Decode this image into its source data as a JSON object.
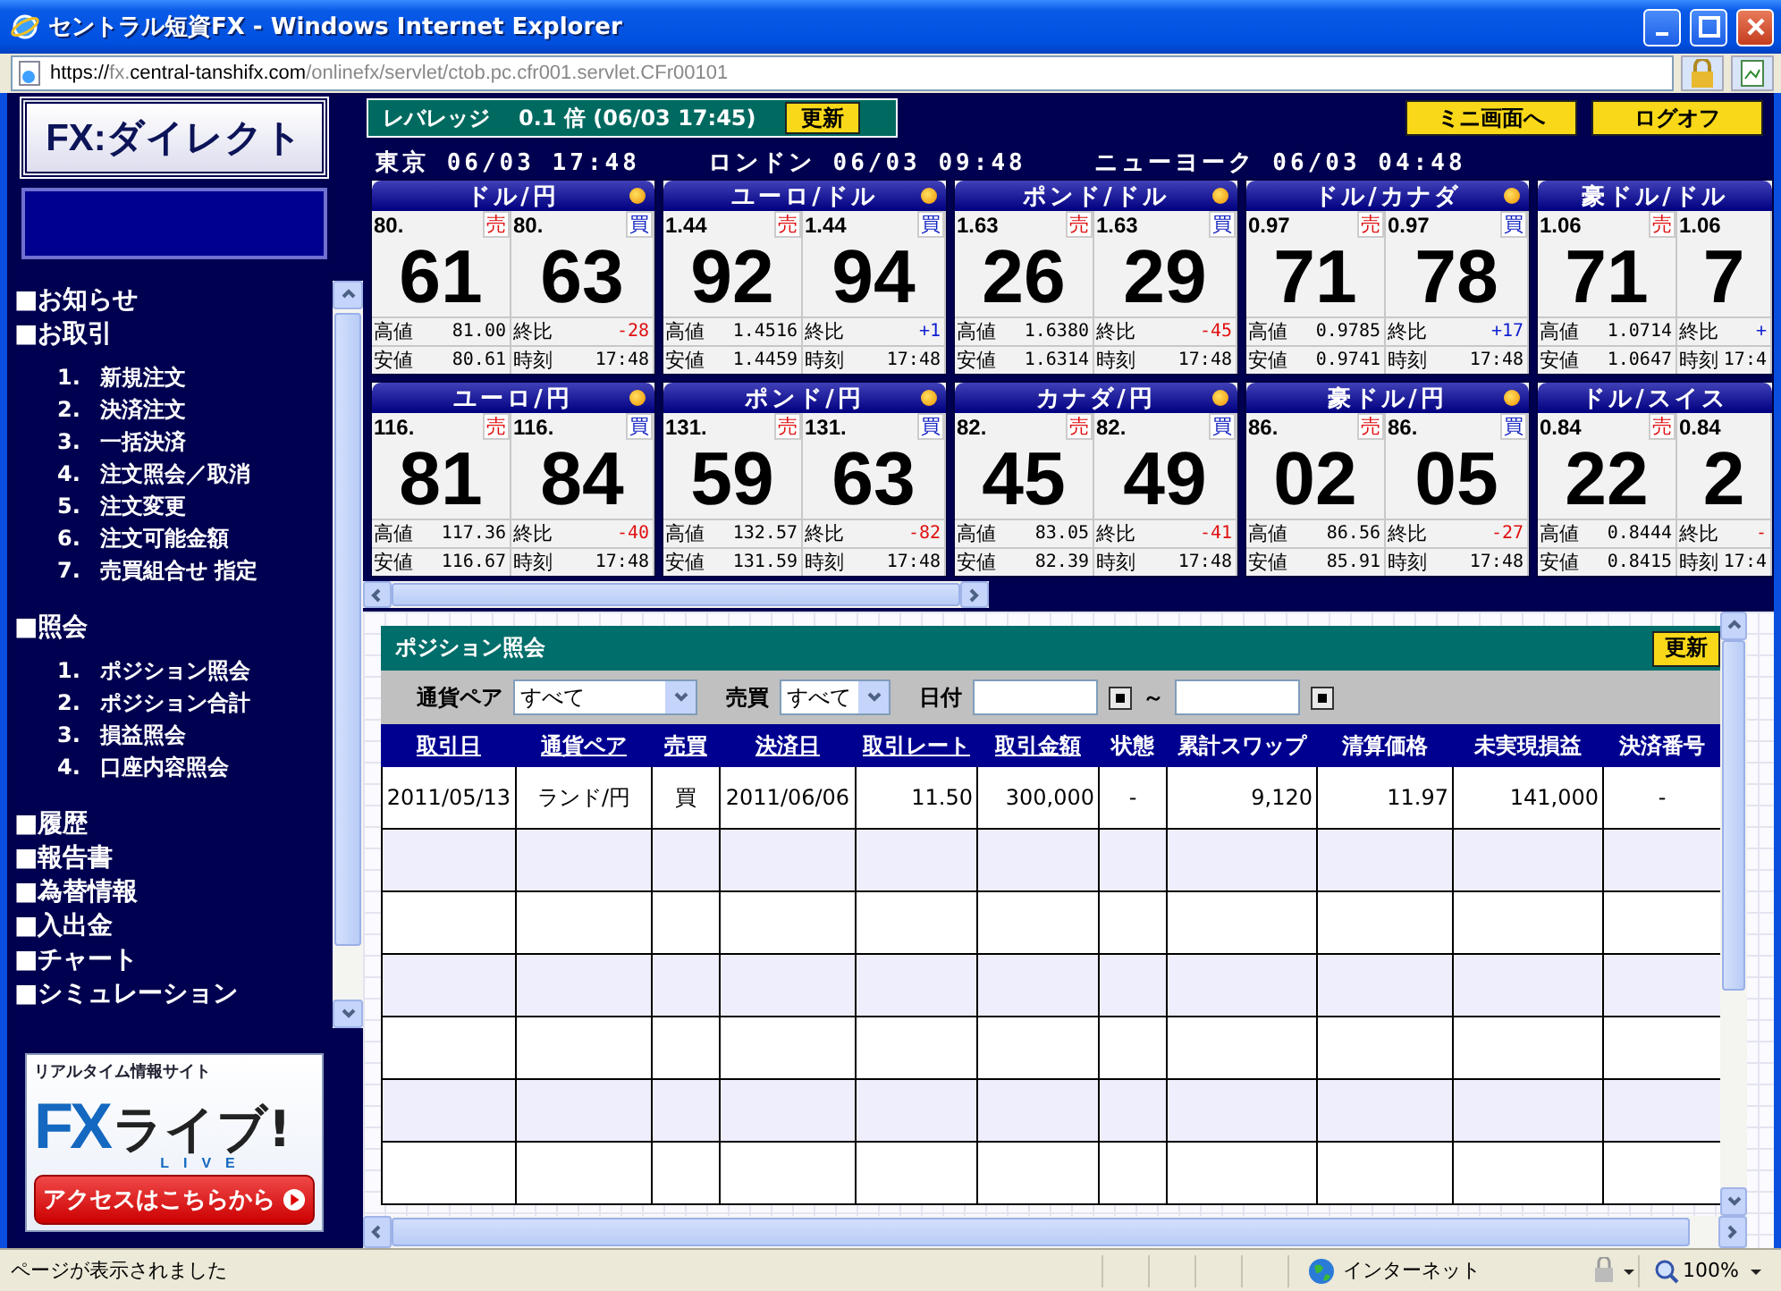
{
  "window": {
    "title": "セントラル短資FX - Windows Internet Explorer",
    "address": {
      "scheme": "https://",
      "subdomain": "fx.",
      "domain": "central-tanshifx.com",
      "path": "/onlinefx/servlet/ctob.pc.cfr001.servlet.CFr00101"
    }
  },
  "sidebar": {
    "logo": "FX:ダイレクト",
    "menu": [
      {
        "label": "■お知らせ"
      },
      {
        "label": "■お取引",
        "children": [
          {
            "number": "1.",
            "label": "新規注文"
          },
          {
            "number": "2.",
            "label": "決済注文"
          },
          {
            "number": "3.",
            "label": "一括決済"
          },
          {
            "number": "4.",
            "label": "注文照会／取消"
          },
          {
            "number": "5.",
            "label": "注文変更"
          },
          {
            "number": "6.",
            "label": "注文可能金額"
          },
          {
            "number": "7.",
            "label": "売買組合せ 指定"
          }
        ]
      },
      {
        "label": "■照会",
        "children": [
          {
            "number": "1.",
            "label": "ポジション照会"
          },
          {
            "number": "2.",
            "label": "ポジション合計"
          },
          {
            "number": "3.",
            "label": "損益照会"
          },
          {
            "number": "4.",
            "label": "口座内容照会"
          }
        ]
      },
      {
        "label": "■履歴"
      },
      {
        "label": "■報告書"
      },
      {
        "label": "■為替情報"
      },
      {
        "label": "■入出金"
      },
      {
        "label": "■チャート"
      },
      {
        "label": "■シミュレーション"
      }
    ],
    "banner": {
      "tagline": "リアルタイム情報サイト",
      "brand_fx": "FX",
      "brand_name": "ライブ!",
      "brand_sub": "LIVE",
      "button": "アクセスはこちらから"
    }
  },
  "header": {
    "leverage": {
      "label": "レバレッジ",
      "value": "0.1 倍",
      "time": "(06/03 17:45)",
      "button": "更新"
    },
    "buttons": [
      "ミニ画面へ",
      "ログオフ"
    ],
    "clocks": [
      {
        "city": "東京",
        "time": "06/03 17:48"
      },
      {
        "city": "ロンドン",
        "time": "06/03 09:48"
      },
      {
        "city": "ニューヨーク",
        "time": "06/03 04:48"
      }
    ]
  },
  "tiles": [
    {
      "pair": "ドル/円",
      "marker": true,
      "bid_head": "80.",
      "sell_label": "売",
      "bid_big": "61",
      "ask_head": "80.",
      "buy_label": "買",
      "ask_big": "63",
      "high_label": "高値",
      "high": "81.00",
      "change_label": "終比",
      "change": "-28",
      "rising": false,
      "low_label": "安値",
      "low": "80.61",
      "time_label": "時刻",
      "time": "17:48"
    },
    {
      "pair": "ユーロ/ドル",
      "marker": true,
      "bid_head": "1.44",
      "sell_label": "売",
      "bid_big": "92",
      "ask_head": "1.44",
      "buy_label": "買",
      "ask_big": "94",
      "high_label": "高値",
      "high": "1.4516",
      "change_label": "終比",
      "change": "+1",
      "rising": true,
      "low_label": "安値",
      "low": "1.4459",
      "time_label": "時刻",
      "time": "17:48"
    },
    {
      "pair": "ポンド/ドル",
      "marker": true,
      "bid_head": "1.63",
      "sell_label": "売",
      "bid_big": "26",
      "ask_head": "1.63",
      "buy_label": "買",
      "ask_big": "29",
      "high_label": "高値",
      "high": "1.6380",
      "change_label": "終比",
      "change": "-45",
      "rising": false,
      "low_label": "安値",
      "low": "1.6314",
      "time_label": "時刻",
      "time": "17:48"
    },
    {
      "pair": "ドル/カナダ",
      "marker": true,
      "bid_head": "0.97",
      "sell_label": "売",
      "bid_big": "71",
      "ask_head": "0.97",
      "buy_label": "買",
      "ask_big": "78",
      "high_label": "高値",
      "high": "0.9785",
      "change_label": "終比",
      "change": "+17",
      "rising": true,
      "low_label": "安値",
      "low": "0.9741",
      "time_label": "時刻",
      "time": "17:48"
    },
    {
      "pair": "豪ドル/ドル",
      "marker": false,
      "bid_head": "1.06",
      "sell_label": "売",
      "bid_big": "71",
      "ask_head": "1.06",
      "ask_big": "7",
      "high_label": "高値",
      "high": "1.0714",
      "change_label": "終比",
      "change": "+",
      "rising": true,
      "low_label": "安値",
      "low": "1.0647",
      "time_label": "時刻",
      "time": "17:4"
    },
    {
      "pair": "ユーロ/円",
      "marker": true,
      "bid_head": "116.",
      "sell_label": "売",
      "bid_big": "81",
      "ask_head": "116.",
      "buy_label": "買",
      "ask_big": "84",
      "high_label": "高値",
      "high": "117.36",
      "change_label": "終比",
      "change": "-40",
      "rising": false,
      "low_label": "安値",
      "low": "116.67",
      "time_label": "時刻",
      "time": "17:48"
    },
    {
      "pair": "ポンド/円",
      "marker": true,
      "bid_head": "131.",
      "sell_label": "売",
      "bid_big": "59",
      "ask_head": "131.",
      "buy_label": "買",
      "ask_big": "63",
      "high_label": "高値",
      "high": "132.57",
      "change_label": "終比",
      "change": "-82",
      "rising": false,
      "low_label": "安値",
      "low": "131.59",
      "time_label": "時刻",
      "time": "17:48"
    },
    {
      "pair": "カナダ/円",
      "marker": true,
      "bid_head": "82.",
      "sell_label": "売",
      "bid_big": "45",
      "ask_head": "82.",
      "buy_label": "買",
      "ask_big": "49",
      "high_label": "高値",
      "high": "83.05",
      "change_label": "終比",
      "change": "-41",
      "rising": false,
      "low_label": "安値",
      "low": "82.39",
      "time_label": "時刻",
      "time": "17:48"
    },
    {
      "pair": "豪ドル/円",
      "marker": true,
      "bid_head": "86.",
      "sell_label": "売",
      "bid_big": "02",
      "ask_head": "86.",
      "buy_label": "買",
      "ask_big": "05",
      "high_label": "高値",
      "high": "86.56",
      "change_label": "終比",
      "change": "-27",
      "rising": false,
      "low_label": "安値",
      "low": "85.91",
      "time_label": "時刻",
      "time": "17:48"
    },
    {
      "pair": "ドル/スイス",
      "marker": false,
      "bid_head": "0.84",
      "sell_label": "売",
      "bid_big": "22",
      "ask_head": "0.84",
      "ask_big": "2",
      "high_label": "高値",
      "high": "0.8444",
      "change_label": "終比",
      "change": "-",
      "rising": false,
      "low_label": "安値",
      "low": "0.8415",
      "time_label": "時刻",
      "time": "17:4"
    }
  ],
  "positions": {
    "title": "ポジション照会",
    "button": "更新",
    "filters": [
      {
        "label": "通貨ペア",
        "value": "すべて"
      },
      {
        "label": "売買",
        "value": "すべて"
      }
    ],
    "date": {
      "label": "日付",
      "separator": "～"
    },
    "table": {
      "columns": [
        {
          "label": "取引日",
          "link": true
        },
        {
          "label": "通貨ペア",
          "link": true
        },
        {
          "label": "売買",
          "link": true
        },
        {
          "label": "決済日",
          "link": true
        },
        {
          "label": "取引レート",
          "link": true
        },
        {
          "label": "取引金額",
          "link": true
        },
        {
          "label": "状態",
          "link": false
        },
        {
          "label": "累計スワップ",
          "link": false
        },
        {
          "label": "清算価格",
          "link": false
        },
        {
          "label": "未実現損益",
          "link": false
        },
        {
          "label": "決済番号",
          "link": false
        }
      ],
      "rows": [
        [
          "2011/05/13",
          "ランド/円",
          "買",
          "2011/06/06",
          "11.50",
          "300,000",
          "-",
          "9,120",
          "11.97",
          "141,000",
          "-"
        ]
      ]
    }
  },
  "status_bar": {
    "message": "ページが表示されました",
    "zone": "インターネット",
    "zoom": "100%"
  }
}
